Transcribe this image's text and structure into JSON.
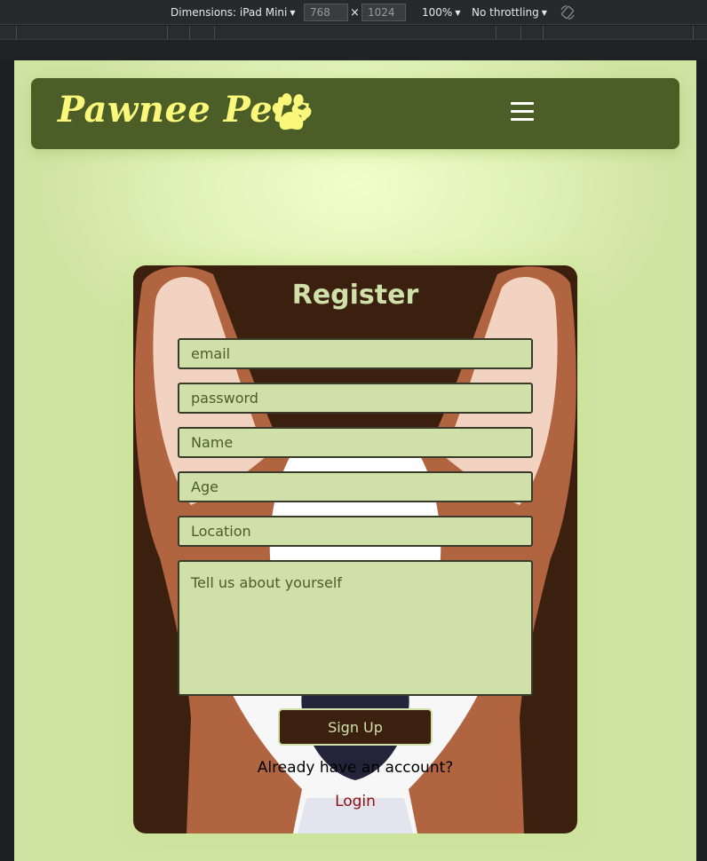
{
  "devtools": {
    "device_label": "Dimensions: iPad Mini",
    "width": "768",
    "height": "1024",
    "zoom": "100%",
    "throttling": "No throttling",
    "times": "×"
  },
  "navbar": {
    "brand": "Pawnee Pets",
    "brand_color": "#fbf77a",
    "icons": [
      "paw-icon",
      "hamburger-menu-icon"
    ]
  },
  "register": {
    "title": "Register",
    "email_placeholder": "email",
    "password_placeholder": "password",
    "name_placeholder": "Name",
    "age_placeholder": "Age",
    "location_placeholder": "Location",
    "about_placeholder": "Tell us about yourself",
    "signup_label": "Sign Up",
    "already_text": "Already have an account?",
    "login_label": "Login"
  },
  "colors": {
    "navbar_bg": "#4c5e28",
    "card_bg": "#3b2010",
    "input_bg": "#cfe0a8",
    "login_link": "#8a1010"
  }
}
